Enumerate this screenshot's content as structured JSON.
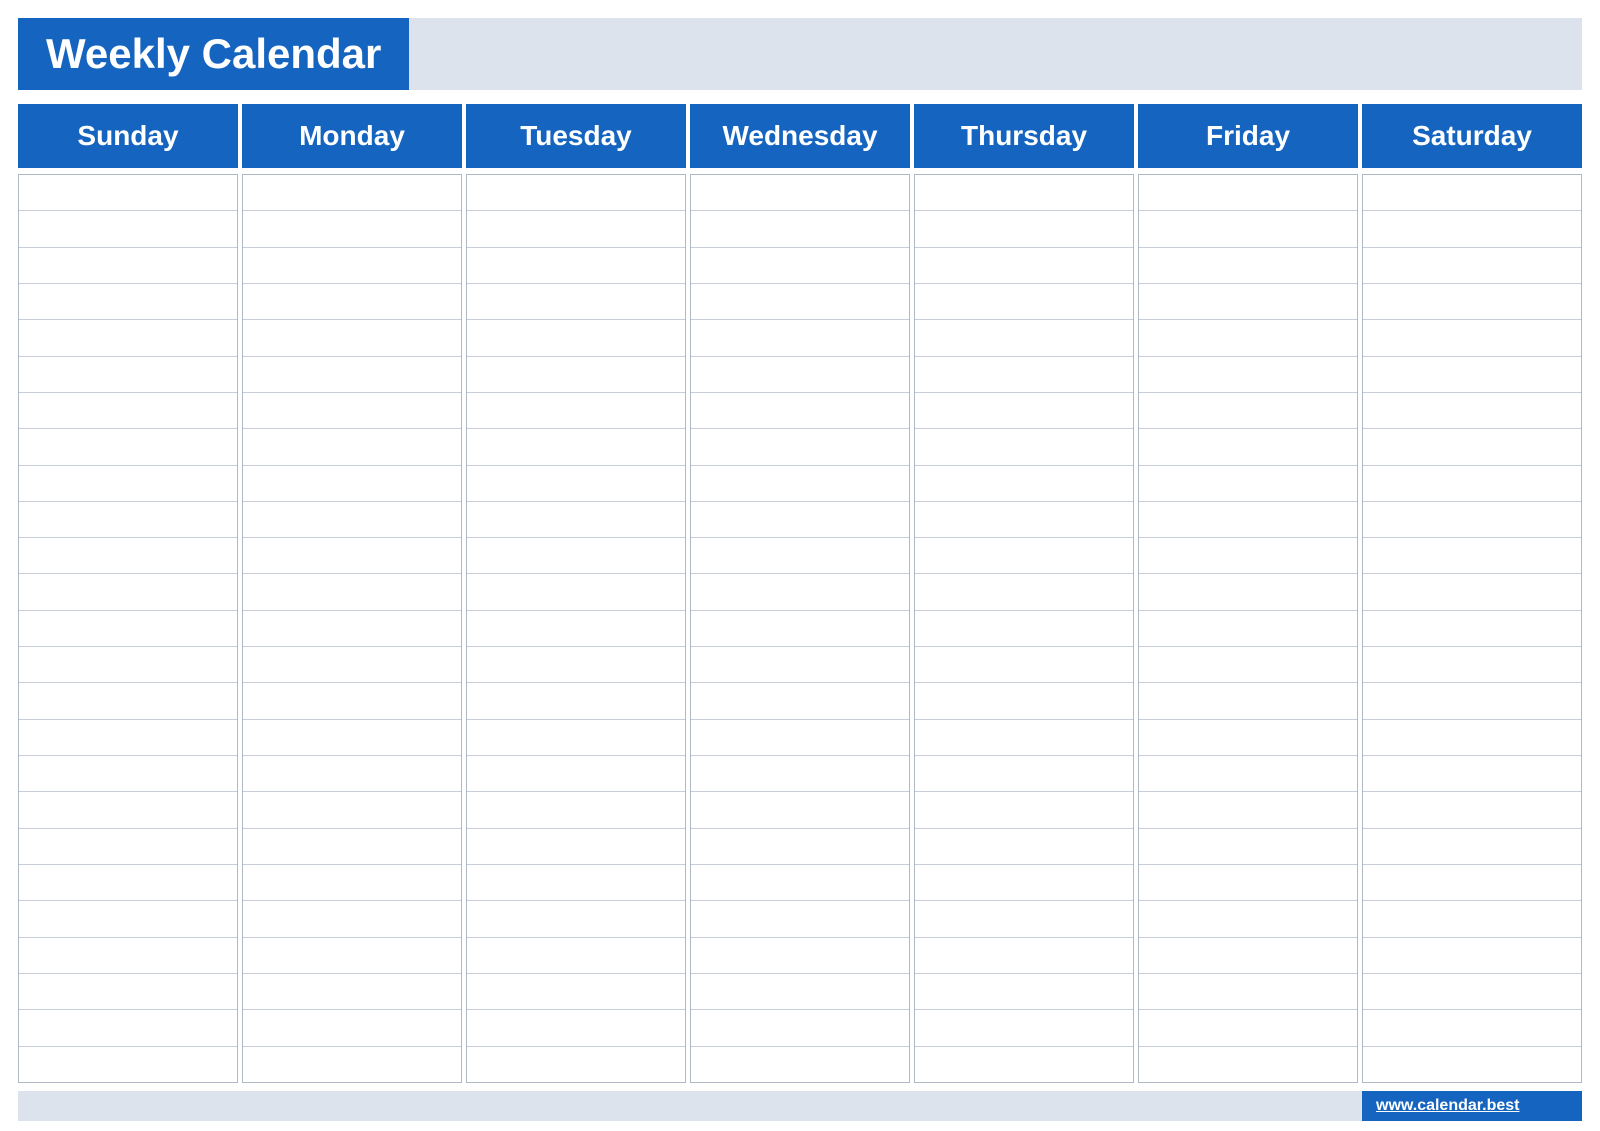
{
  "header": {
    "title": "Weekly Calendar"
  },
  "days": [
    {
      "id": "sunday",
      "label": "Sunday"
    },
    {
      "id": "monday",
      "label": "Monday"
    },
    {
      "id": "tuesday",
      "label": "Tuesday"
    },
    {
      "id": "wednesday",
      "label": "Wednesday"
    },
    {
      "id": "thursday",
      "label": "Thursday"
    },
    {
      "id": "friday",
      "label": "Friday"
    },
    {
      "id": "saturday",
      "label": "Saturday"
    }
  ],
  "rows_count": 25,
  "footer": {
    "url": "www.calendar.best"
  }
}
